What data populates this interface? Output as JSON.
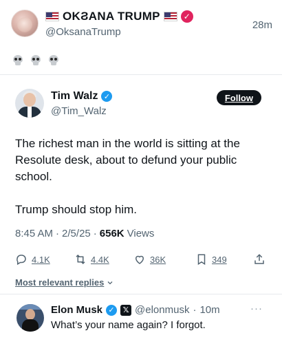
{
  "outer": {
    "display_name": "OKϨANA TRUMP",
    "handle": "@OksanaTrump",
    "time": "28m",
    "reaction_emojis": [
      "skull-emoji",
      "skull-emoji",
      "skull-emoji"
    ],
    "verified_color": "#e0245e"
  },
  "quoted": {
    "name": "Tim Walz",
    "handle": "@Tim_Walz",
    "follow_label": "Follow",
    "text_line_1": "The richest man in the world is sitting at the Resolute desk, about to defund your public school.",
    "text_line_2": "Trump should stop him.",
    "time": "8:45 AM",
    "date": "2/5/25",
    "views_count": "656K",
    "views_label": "Views",
    "verified_color": "#1d9bf0"
  },
  "actions": {
    "replies": "4.1K",
    "reposts": "4.4K",
    "likes": "36K",
    "bookmarks": "349"
  },
  "replies_filter_label": "Most relevant replies",
  "reply": {
    "name": "Elon Musk",
    "handle": "@elonmusk",
    "time": "10m",
    "text": "What’s your name again? I forgot.",
    "more_label": "···"
  },
  "colors": {
    "text_primary": "#0f1419",
    "text_secondary": "#536471",
    "accent_blue": "#1d9bf0"
  }
}
